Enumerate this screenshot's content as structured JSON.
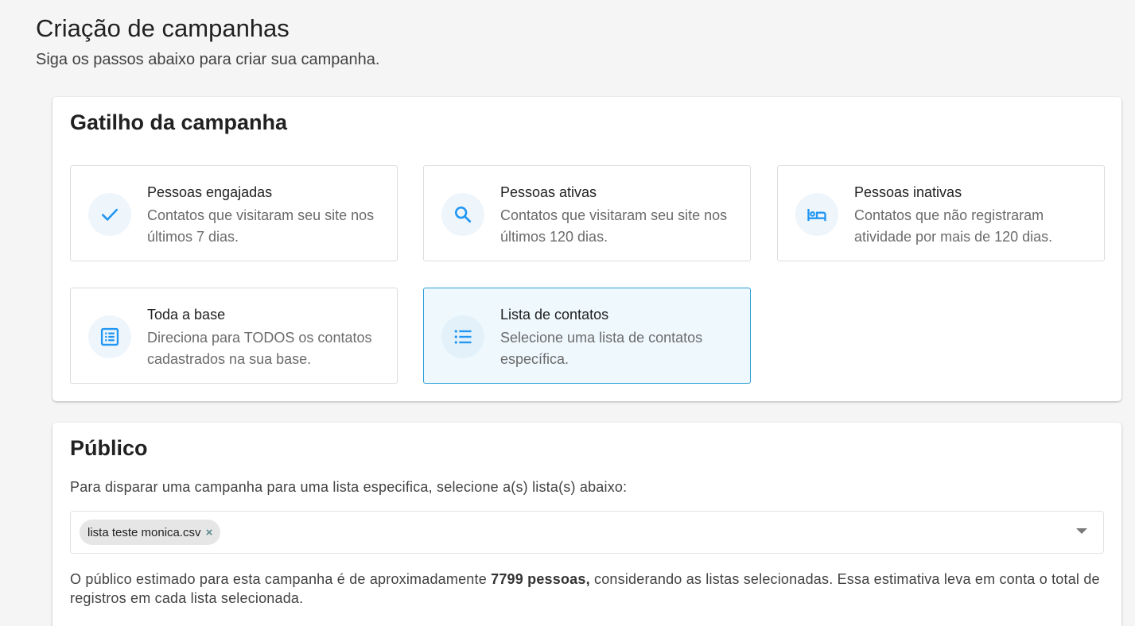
{
  "header": {
    "title": "Criação de campanhas",
    "subtitle": "Siga os passos abaixo para criar sua campanha."
  },
  "trigger": {
    "title": "Gatilho da campanha",
    "options": [
      {
        "title": "Pessoas engajadas",
        "description": "Contatos que visitaram seu site nos últimos 7 dias.",
        "icon": "check-icon",
        "selected": false
      },
      {
        "title": "Pessoas ativas",
        "description": "Contatos que visitaram seu site nos últimos 120 dias.",
        "icon": "search-icon",
        "selected": false
      },
      {
        "title": "Pessoas inativas",
        "description": "Contatos que não registraram atividade por mais de 120 dias.",
        "icon": "bed-icon",
        "selected": false
      },
      {
        "title": "Toda a base",
        "description": "Direciona para TODOS os contatos cadastrados na sua base.",
        "icon": "list-alt-icon",
        "selected": false
      },
      {
        "title": "Lista de contatos",
        "description": "Selecione uma lista de contatos específica.",
        "icon": "format-list-icon",
        "selected": true
      }
    ]
  },
  "public": {
    "title": "Público",
    "label": "Para disparar uma campanha para uma lista especifica, selecione a(s) lista(s) abaixo:",
    "selected_lists": [
      "lista teste monica.csv"
    ],
    "estimate_prefix": "O público estimado para esta campanha é de aproximadamente ",
    "estimate_count": "7799 pessoas,",
    "estimate_suffix": " considerando as listas selecionadas. Essa estimativa leva em conta o total de registros em cada lista selecionada."
  },
  "colors": {
    "accent": "#2196f3",
    "selected_border": "#2a9fd8",
    "selected_bg": "#eef8fd"
  }
}
